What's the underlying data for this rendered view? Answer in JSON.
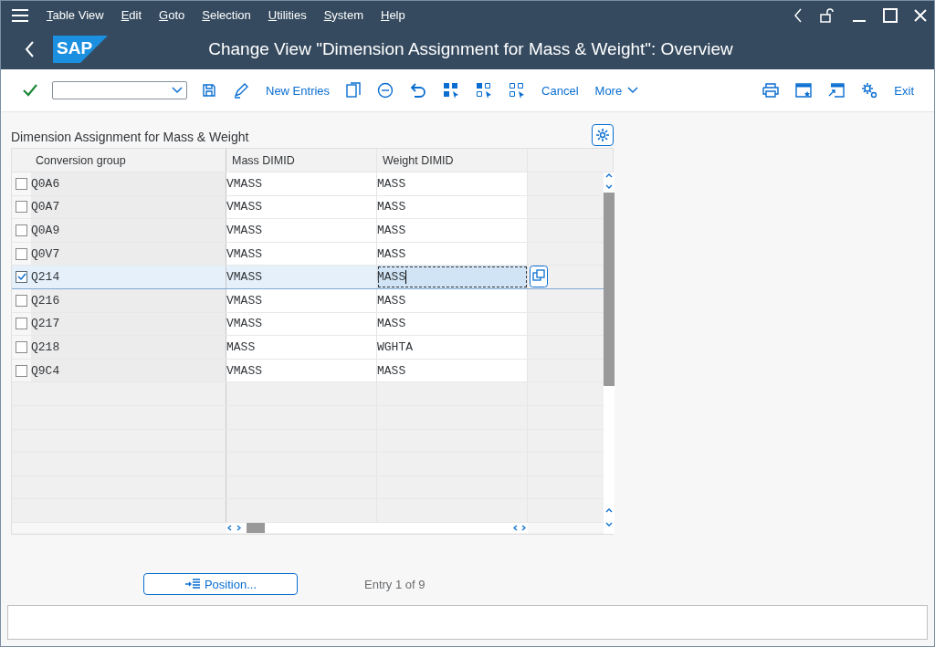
{
  "menu": [
    "Table View",
    "Edit",
    "Goto",
    "Selection",
    "Utilities",
    "System",
    "Help"
  ],
  "logo": "SAP",
  "title": "Change View \"Dimension Assignment for Mass & Weight\": Overview",
  "toolbar": {
    "new_entries": "New Entries",
    "cancel": "Cancel",
    "more": "More",
    "exit": "Exit"
  },
  "table": {
    "title": "Dimension Assignment for Mass & Weight",
    "columns": [
      "Conversion group",
      "Mass DIMID",
      "Weight DIMID"
    ],
    "rows": [
      {
        "cells": [
          "Q0A6",
          "VMASS",
          "MASS"
        ],
        "checked": false,
        "selected": false,
        "focused": false
      },
      {
        "cells": [
          "Q0A7",
          "VMASS",
          "MASS"
        ],
        "checked": false,
        "selected": false,
        "focused": false
      },
      {
        "cells": [
          "Q0A9",
          "VMASS",
          "MASS"
        ],
        "checked": false,
        "selected": false,
        "focused": false
      },
      {
        "cells": [
          "Q0V7",
          "VMASS",
          "MASS"
        ],
        "checked": false,
        "selected": false,
        "focused": false
      },
      {
        "cells": [
          "Q214",
          "VMASS",
          "MASS"
        ],
        "checked": true,
        "selected": true,
        "focused": true
      },
      {
        "cells": [
          "Q216",
          "VMASS",
          "MASS"
        ],
        "checked": false,
        "selected": false,
        "focused": false
      },
      {
        "cells": [
          "Q217",
          "VMASS",
          "MASS"
        ],
        "checked": false,
        "selected": false,
        "focused": false
      },
      {
        "cells": [
          "Q218",
          "MASS",
          "WGHTA"
        ],
        "checked": false,
        "selected": false,
        "focused": false
      },
      {
        "cells": [
          "Q9C4",
          "VMASS",
          "MASS"
        ],
        "checked": false,
        "selected": false,
        "focused": false
      }
    ]
  },
  "position_button": "Position...",
  "entry_info": "Entry 1 of 9"
}
